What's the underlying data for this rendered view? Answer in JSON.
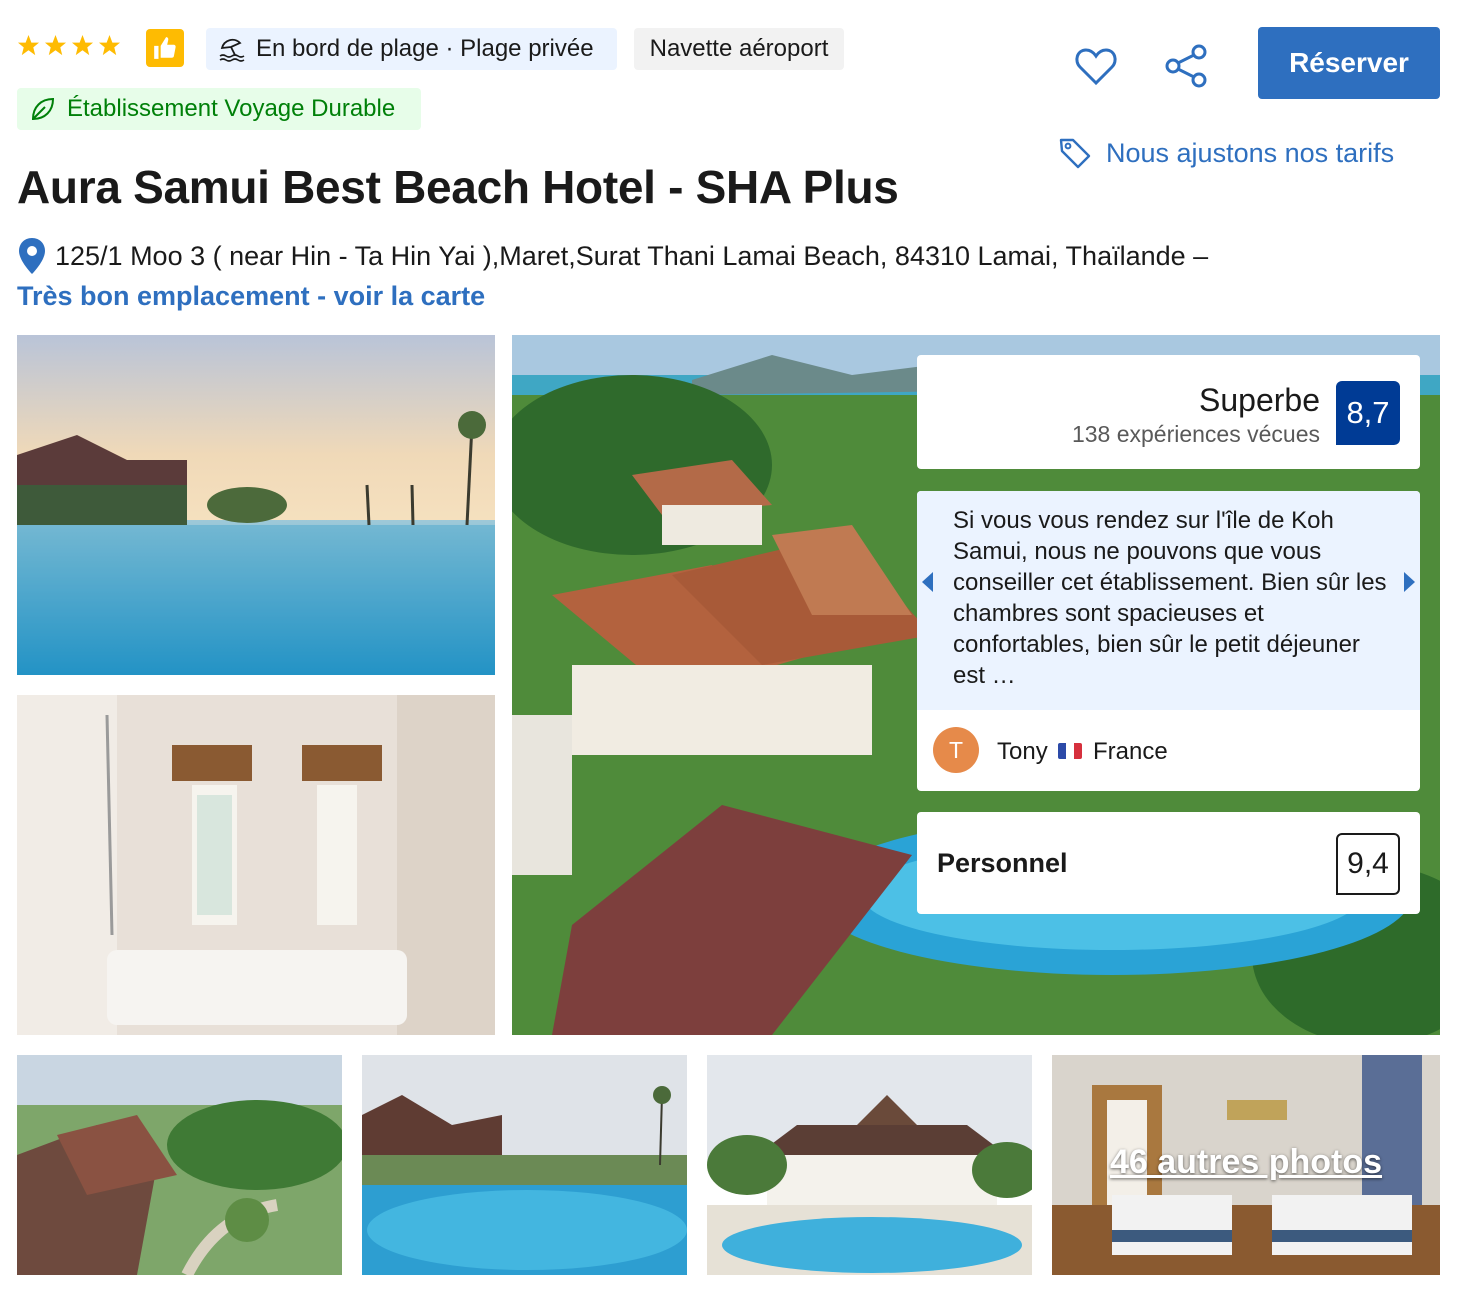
{
  "header": {
    "star_count": 4,
    "colors": {
      "star": "#febb02",
      "brand_blue": "#2e6fbf",
      "score_blue": "#003b95",
      "eco_green": "#008009"
    },
    "beach_chip": "En bord de plage · Plage privée",
    "shuttle_chip": "Navette aéroport",
    "eco_chip": "Établissement Voyage Durable",
    "reserve_label": "Réserver",
    "price_link": "Nous ajustons nos tarifs",
    "icons": [
      "star-icon",
      "thumbs-up-icon",
      "beach-icon",
      "leaf-icon",
      "heart-icon",
      "share-icon",
      "tag-icon",
      "location-pin-icon"
    ]
  },
  "hotel": {
    "title": "Aura Samui Best Beach Hotel - SHA Plus",
    "address": "125/1 Moo 3 ( near Hin - Ta Hin Yai ),Maret,Surat Thani Lamai Beach, 84310 Lamai, Thaïlande –",
    "map_link": "Très bon emplacement - voir la carte"
  },
  "rating": {
    "label": "Superbe",
    "count": "138 expériences vécues",
    "score": "8,7"
  },
  "review": {
    "text": "Si vous vous rendez sur l'île de Koh Samui, nous ne pouvons que vous conseiller cet établissement. Bien sûr les chambres sont spacieuses et confortables, bien sûr le petit déjeuner est …",
    "avatar_letter": "T",
    "reviewer": "Tony",
    "country": "France"
  },
  "staff": {
    "label": "Personnel",
    "score": "9,4"
  },
  "gallery": {
    "more_photos": "46 autres photos"
  }
}
